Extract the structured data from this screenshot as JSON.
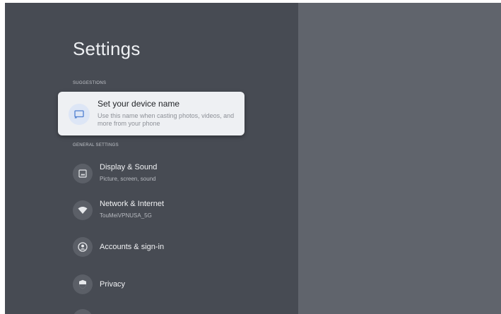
{
  "settings": {
    "title": "Settings",
    "suggestions_header": "SUGGESTIONS",
    "general_header": "GENERAL SETTINGS",
    "suggestion": {
      "title": "Set your device name",
      "description": "Use this name when casting photos, videos, and more from your phone",
      "icon": "cast-device-icon"
    },
    "items": [
      {
        "title": "Display & Sound",
        "subtitle": "Picture, screen, sound",
        "icon": "image-icon"
      },
      {
        "title": "Network & Internet",
        "subtitle": "TouMeiVPNUSA_5G",
        "icon": "wifi-icon"
      },
      {
        "title": "Accounts & sign-in",
        "subtitle": "",
        "icon": "account-icon"
      },
      {
        "title": "Privacy",
        "subtitle": "",
        "icon": "shield-icon"
      }
    ]
  },
  "colors": {
    "panel": "#474b53",
    "background": "#60646c",
    "card": "#eef0f3",
    "icon_circle": "#5b5f67"
  }
}
